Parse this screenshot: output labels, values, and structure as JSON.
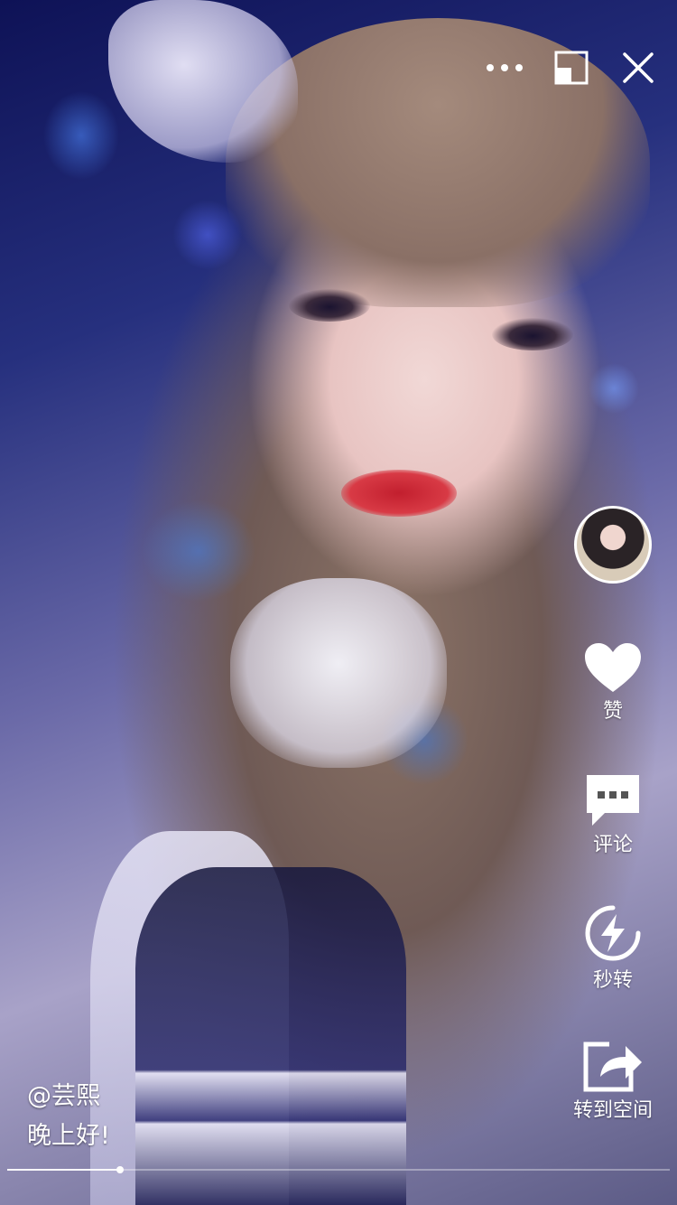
{
  "video": {
    "author": "@芸熙",
    "caption": "晚上好!",
    "progress": 0.17
  },
  "top_controls": [
    {
      "name": "more",
      "icon": "more-dots-icon"
    },
    {
      "name": "minimize",
      "icon": "minimize-window-icon"
    },
    {
      "name": "close",
      "icon": "close-icon"
    }
  ],
  "rail": {
    "avatar_icon": "user-avatar",
    "like": {
      "label": "赞",
      "icon": "heart-icon"
    },
    "comment": {
      "label": "评论",
      "icon": "comment-bubble-icon"
    },
    "quick_repost": {
      "label": "秒转",
      "icon": "lightning-circle-icon"
    },
    "share": {
      "label": "转到空间",
      "icon": "share-arrow-icon"
    }
  },
  "colors": {
    "text": "#ffffff",
    "accent": "#ffffff"
  }
}
